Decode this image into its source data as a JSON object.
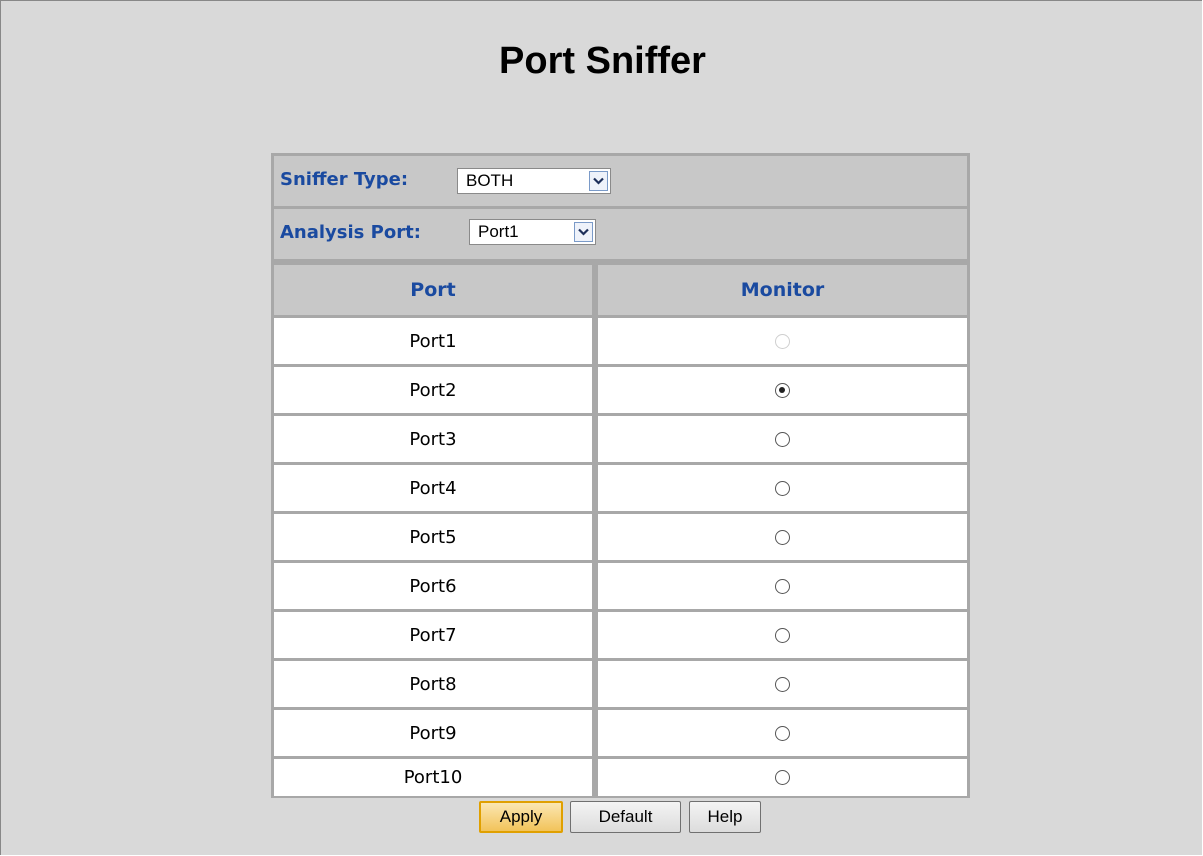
{
  "page": {
    "title": "Port Sniffer"
  },
  "settings": {
    "sniffer_type_label": "Sniffer Type:",
    "sniffer_type_value": "BOTH",
    "analysis_port_label": "Analysis Port:",
    "analysis_port_value": "Port1"
  },
  "table": {
    "headers": [
      "Port",
      "Monitor"
    ],
    "rows": [
      {
        "port": "Port1",
        "monitor": "disabled"
      },
      {
        "port": "Port2",
        "monitor": "checked"
      },
      {
        "port": "Port3",
        "monitor": "unchecked"
      },
      {
        "port": "Port4",
        "monitor": "unchecked"
      },
      {
        "port": "Port5",
        "monitor": "unchecked"
      },
      {
        "port": "Port6",
        "monitor": "unchecked"
      },
      {
        "port": "Port7",
        "monitor": "unchecked"
      },
      {
        "port": "Port8",
        "monitor": "unchecked"
      },
      {
        "port": "Port9",
        "monitor": "unchecked"
      },
      {
        "port": "Port10",
        "monitor": "unchecked"
      }
    ]
  },
  "buttons": {
    "apply": "Apply",
    "default": "Default",
    "help": "Help"
  },
  "icons": {
    "select_arrow": "chevron-down-icon"
  },
  "colors": {
    "label_blue": "#1a4aa0",
    "apply_highlight": "#e0a000"
  }
}
